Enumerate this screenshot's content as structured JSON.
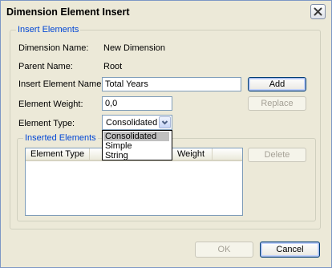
{
  "window": {
    "title": "Dimension Element Insert"
  },
  "insert_group": {
    "legend": "Insert Elements",
    "dimension_name_label": "Dimension Name:",
    "dimension_name_value": "New Dimension",
    "parent_name_label": "Parent Name:",
    "parent_name_value": "Root",
    "insert_element_name_label": "Insert Element Name:",
    "insert_element_name_value": "Total Years",
    "add_label": "Add",
    "element_weight_label": "Element Weight:",
    "element_weight_value": "0,0",
    "replace_label": "Replace",
    "element_type_label": "Element Type:",
    "element_type_selected": "Consolidated",
    "element_type_options": [
      "Consolidated",
      "Simple",
      "String"
    ]
  },
  "inserted_group": {
    "legend": "Inserted Elements",
    "columns": [
      "Element Type",
      "",
      "Weight"
    ],
    "delete_label": "Delete"
  },
  "footer": {
    "ok_label": "OK",
    "cancel_label": "Cancel"
  }
}
